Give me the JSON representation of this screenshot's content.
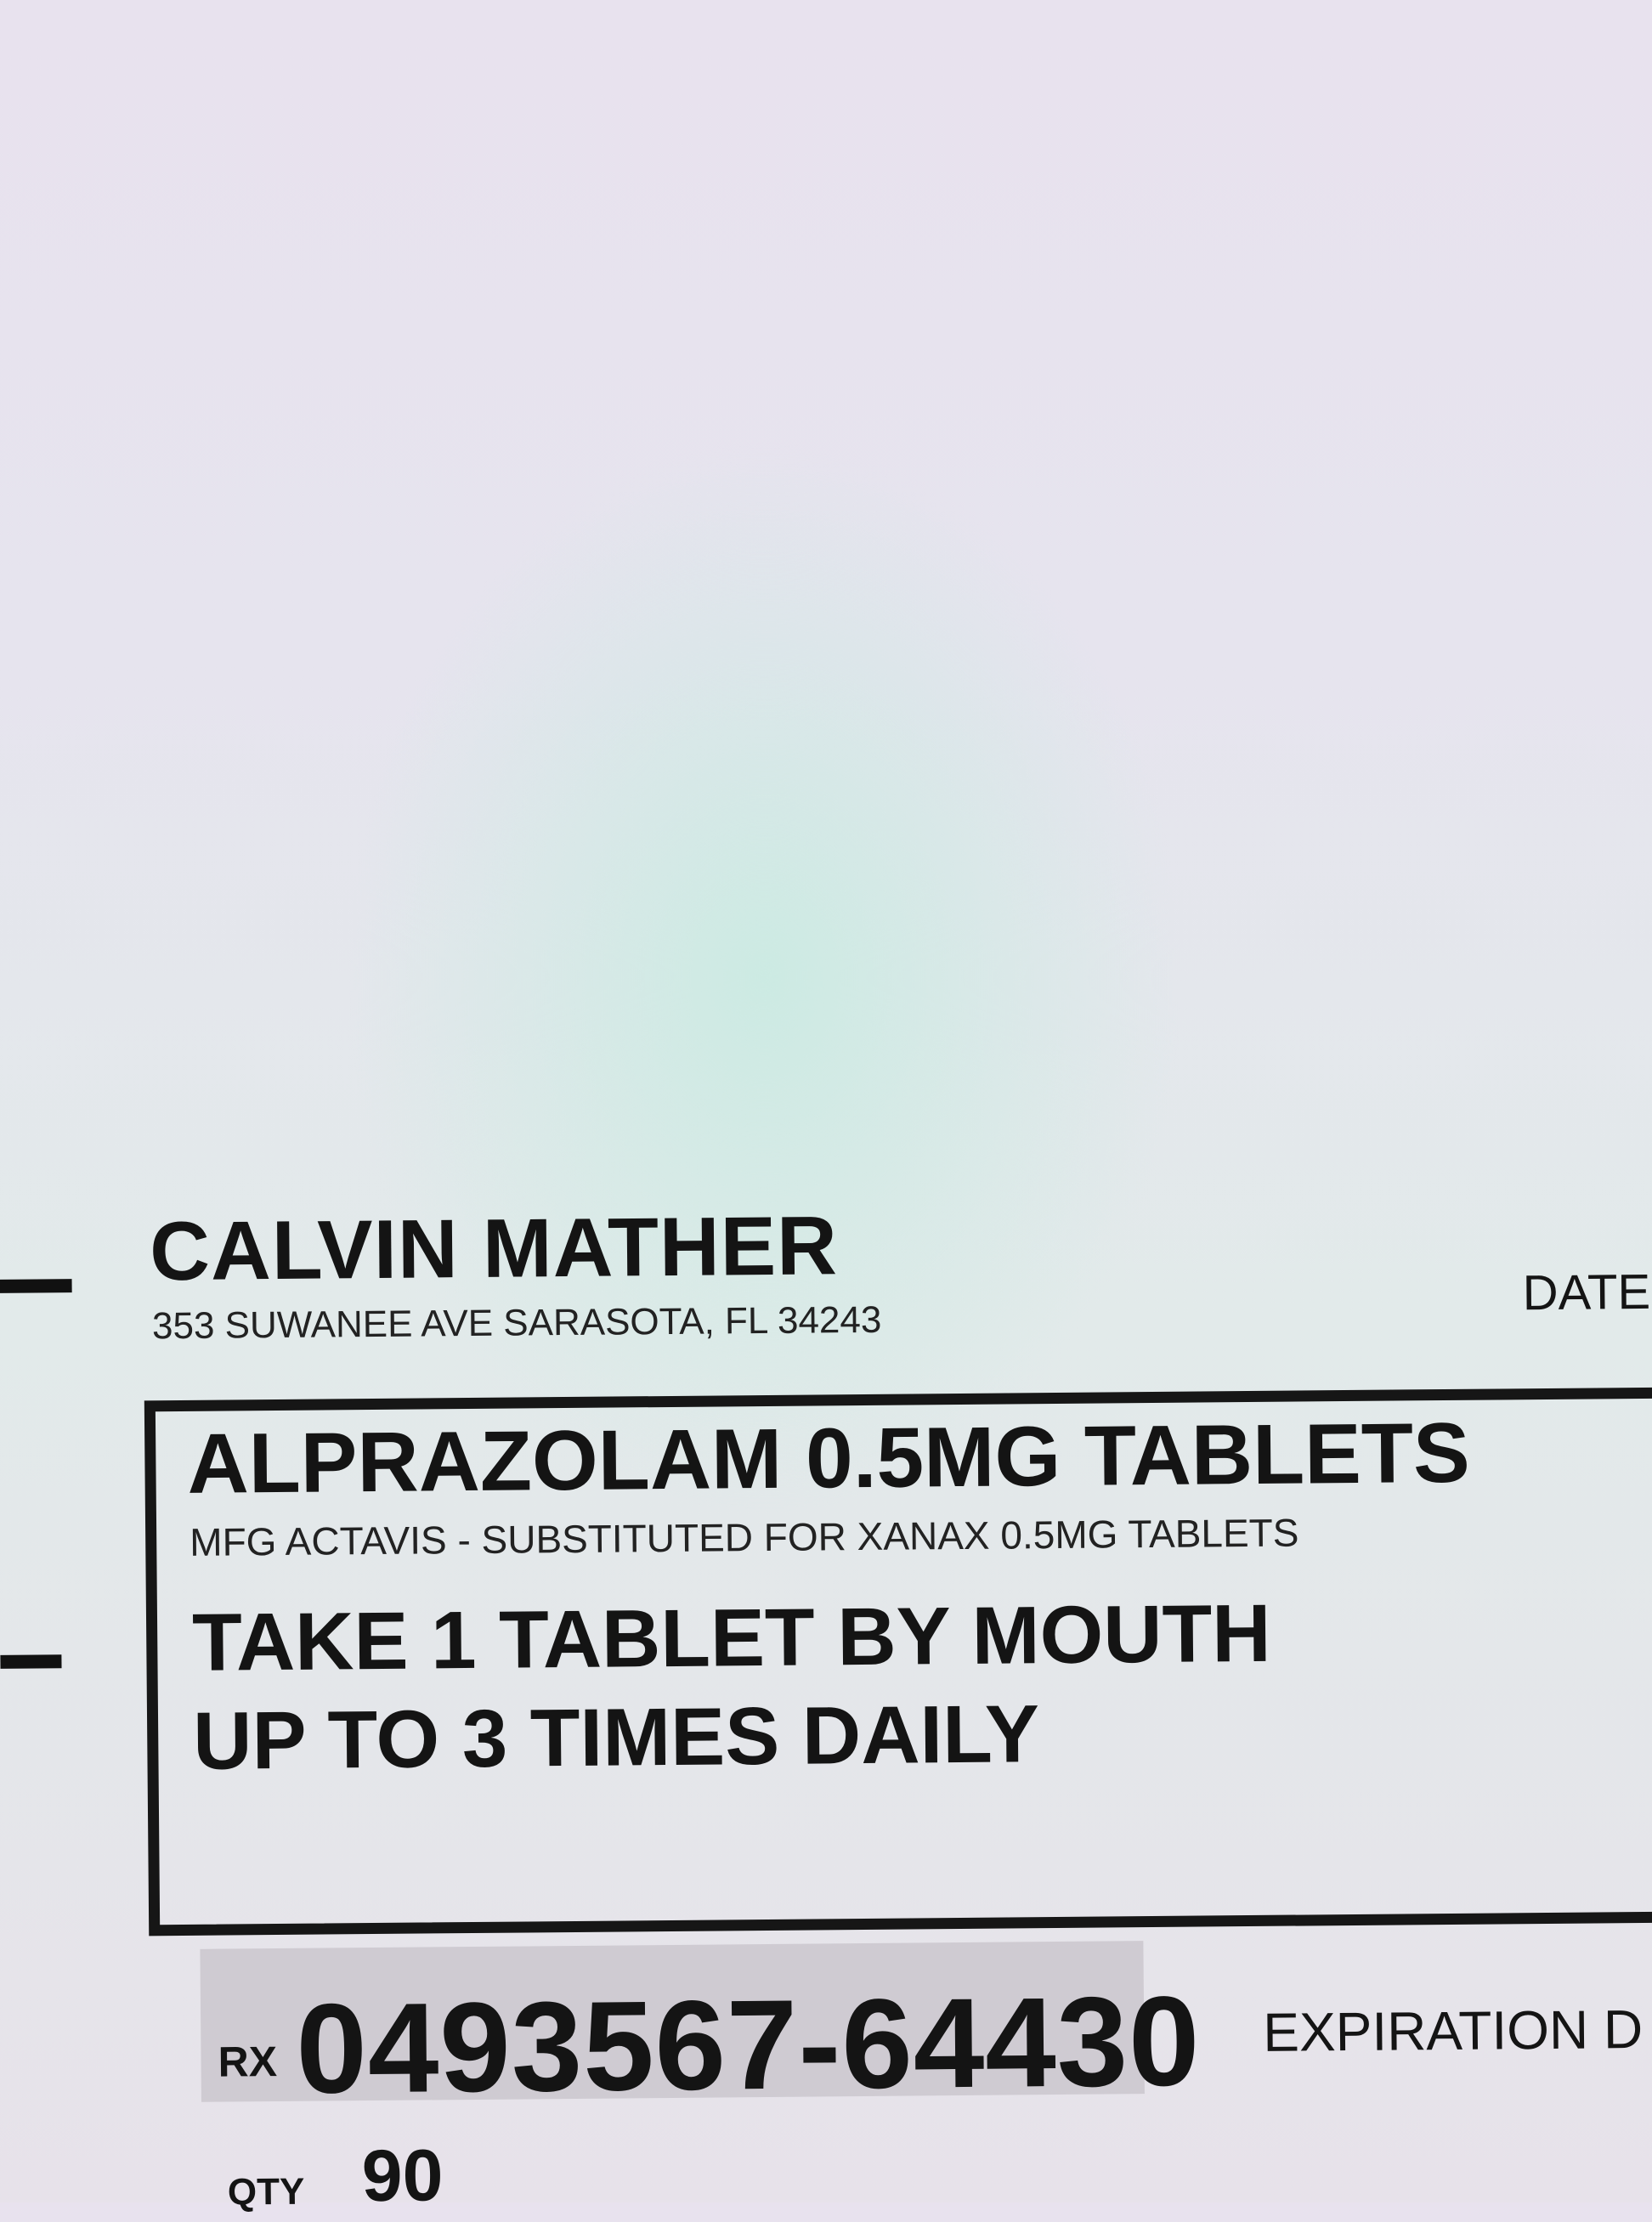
{
  "patient": {
    "name": "CALVIN MATHER",
    "address": "353 SUWANEE AVE SARASOTA, FL 34243"
  },
  "date_label": "DATE",
  "medication": {
    "name": "ALPRAZOLAM 0.5MG TABLETS",
    "manufacturer_note": "MFG ACTAVIS - SUBSTITUTED FOR XANAX 0.5MG TABLETS",
    "directions_line1": "TAKE 1 TABLET BY MOUTH",
    "directions_line2": "UP TO 3 TIMES DAILY"
  },
  "rx": {
    "prefix": "RX",
    "number": "0493567-64430"
  },
  "expiration_label": "EXPIRATION D",
  "quantity": {
    "label": "QTY",
    "value": "90"
  }
}
